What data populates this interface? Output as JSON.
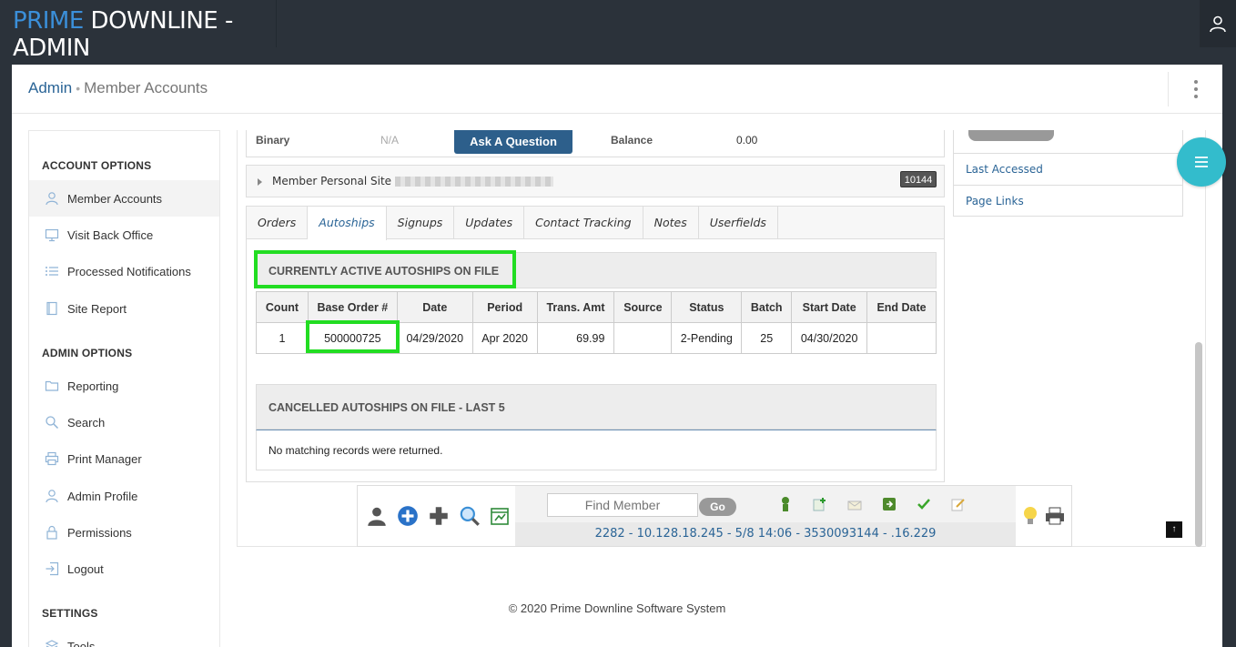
{
  "brand": {
    "part1": "PRIME",
    "part2": " DOWNLINE - ADMIN"
  },
  "breadcrumb": {
    "root": "Admin",
    "current": "Member Accounts"
  },
  "sidebar": {
    "account_heading": "ACCOUNT OPTIONS",
    "account_items": [
      "Member Accounts",
      "Visit Back Office",
      "Processed Notifications",
      "Site Report"
    ],
    "admin_heading": "ADMIN OPTIONS",
    "admin_items": [
      "Reporting",
      "Search",
      "Print Manager",
      "Admin Profile",
      "Permissions",
      "Logout"
    ],
    "settings_heading": "SETTINGS",
    "settings_items": [
      "Tools"
    ]
  },
  "summary": {
    "binary_label": "Binary",
    "binary_value": "N/A",
    "ask_button": "Ask A Question",
    "balance_label": "Balance",
    "balance_value": "0.00"
  },
  "site_bar": {
    "label": "Member Personal Site - ",
    "badge": "10144"
  },
  "tabs": [
    "Orders",
    "Autoships",
    "Signups",
    "Updates",
    "Contact Tracking",
    "Notes",
    "Userfields"
  ],
  "active_section": {
    "title": "CURRENTLY ACTIVE AUTOSHIPS ON FILE",
    "columns": [
      "Count",
      "Base Order #",
      "Date",
      "Period",
      "Trans. Amt",
      "Source",
      "Status",
      "Batch",
      "Start Date",
      "End Date"
    ],
    "rows": [
      [
        "1",
        "500000725",
        "04/29/2020",
        "Apr 2020",
        "69.99",
        "",
        "2-Pending",
        "25",
        "04/30/2020",
        ""
      ]
    ]
  },
  "cancelled_section": {
    "title": "CANCELLED AUTOSHIPS ON FILE - LAST 5",
    "empty_text": "No matching records were returned."
  },
  "right_panel": {
    "items": [
      "Last Accessed",
      "Page Links"
    ]
  },
  "toolbar": {
    "find_placeholder": "Find Member",
    "go_label": "Go",
    "ip_line": "2282 - 10.128.18.245 - 5/8 14:06 - 3530093144 - .16.229"
  },
  "footer": "© 2020 Prime Downline Software System",
  "colors": {
    "accent": "#2a6496",
    "highlight": "#22dd22",
    "fab": "#33bccc",
    "topbar": "#2b323a"
  }
}
